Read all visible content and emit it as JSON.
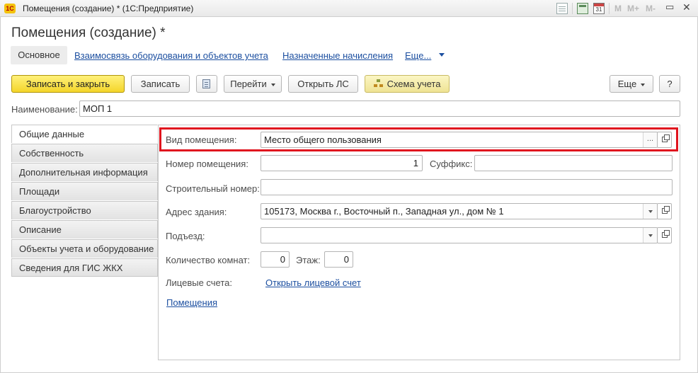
{
  "window": {
    "title": "Помещения (создание) * (1С:Предприятие)",
    "logo_text": "1С",
    "calendar_day": "31",
    "memory_buttons": [
      "M",
      "M+",
      "M-"
    ]
  },
  "page_title": "Помещения (создание) *",
  "nav_tabs": [
    {
      "label": "Основное"
    },
    {
      "label": "Взаимосвязь оборудования и объектов учета"
    },
    {
      "label": "Назначенные начисления"
    },
    {
      "label": "Еще..."
    }
  ],
  "toolbar": {
    "save_close": "Записать и закрыть",
    "save": "Записать",
    "goto": "Перейти",
    "open_ls": "Открыть ЛС",
    "schema": "Схема учета",
    "more": "Еще",
    "help": "?"
  },
  "name_field": {
    "label": "Наименование:",
    "value": "МОП 1"
  },
  "side_tabs": [
    "Общие данные",
    "Собственность",
    "Дополнительная информация",
    "Площади",
    "Благоустройство",
    "Описание",
    "Объекты учета и оборудование",
    "Сведения для ГИС ЖКХ"
  ],
  "form": {
    "room_type": {
      "label": "Вид помещения:",
      "value": "Место общего пользования",
      "button": "..."
    },
    "room_number": {
      "label": "Номер помещения:",
      "value": "1"
    },
    "suffix": {
      "label": "Суффикс:",
      "value": ""
    },
    "build_number": {
      "label": "Строительный номер:",
      "value": ""
    },
    "address": {
      "label": "Адрес здания:",
      "value": "105173, Москва г., Восточный п., Западная ул., дом № 1"
    },
    "entrance": {
      "label": "Подъезд:",
      "value": ""
    },
    "rooms_count": {
      "label": "Количество комнат:",
      "value": "0"
    },
    "floor": {
      "label": "Этаж:",
      "value": "0"
    },
    "accounts": {
      "label": "Лицевые счета:",
      "link": "Открыть лицевой счет"
    },
    "rooms_link": "Помещения"
  },
  "colors": {
    "primary_button": "#f4d52a",
    "link": "#1c4fa0",
    "highlight": "#e0141e"
  }
}
